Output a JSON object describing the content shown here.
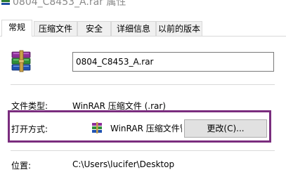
{
  "window": {
    "title": "0804_C8453_A.rar 属性"
  },
  "tabs": [
    {
      "label": "常规"
    },
    {
      "label": "压缩文件"
    },
    {
      "label": "安全"
    },
    {
      "label": "详细信息"
    },
    {
      "label": "以前的版本"
    }
  ],
  "general": {
    "file_name": "0804_C8453_A.rar",
    "file_type_label": "文件类型:",
    "file_type_value": "WinRAR 压缩文件 (.rar)",
    "open_with_label": "打开方式:",
    "open_with_app": "WinRAR 压缩文件管理器",
    "change_button": "更改(C)...",
    "location_label": "位置:",
    "location_value": "C:\\Users\\lucifer\\Desktop"
  },
  "colors": {
    "highlight_border": "#7a2d7e",
    "tab_border": "#d9d9d9",
    "button_bg": "#e1e1e1"
  },
  "icons": {
    "file_icon": "winrar-archive-icon",
    "app_icon": "winrar-app-icon"
  }
}
